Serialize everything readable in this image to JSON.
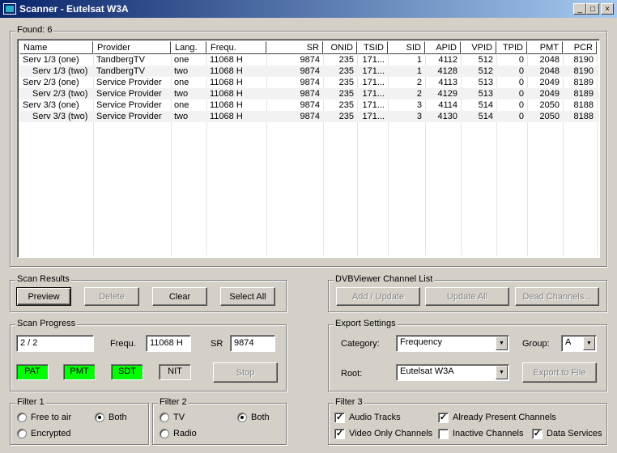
{
  "window": {
    "title": "Scanner - Eutelsat W3A",
    "min": "_",
    "max": "□",
    "close": "×"
  },
  "found": {
    "label": "Found:",
    "count": "6"
  },
  "columns": [
    "Name",
    "Provider",
    "Lang.",
    "Frequ.",
    "SR",
    "ONID",
    "TSID",
    "SID",
    "APID",
    "VPID",
    "TPID",
    "PMT",
    "PCR"
  ],
  "rows": [
    [
      "Serv 1/3 (one)",
      "TandbergTV",
      "one",
      "11068 H",
      "9874",
      "235",
      "171...",
      "1",
      "4112",
      "512",
      "0",
      "2048",
      "8190"
    ],
    [
      "Serv 1/3 (two)",
      "TandbergTV",
      "two",
      "11068 H",
      "9874",
      "235",
      "171...",
      "1",
      "4128",
      "512",
      "0",
      "2048",
      "8190"
    ],
    [
      "Serv 2/3 (one)",
      "Service Provider",
      "one",
      "11068 H",
      "9874",
      "235",
      "171...",
      "2",
      "4113",
      "513",
      "0",
      "2049",
      "8189"
    ],
    [
      "Serv 2/3 (two)",
      "Service Provider",
      "two",
      "11068 H",
      "9874",
      "235",
      "171...",
      "2",
      "4129",
      "513",
      "0",
      "2049",
      "8189"
    ],
    [
      "Serv 3/3 (one)",
      "Service Provider",
      "one",
      "11068 H",
      "9874",
      "235",
      "171...",
      "3",
      "4114",
      "514",
      "0",
      "2050",
      "8188"
    ],
    [
      "Serv 3/3 (two)",
      "Service Provider",
      "two",
      "11068 H",
      "9874",
      "235",
      "171...",
      "3",
      "4130",
      "514",
      "0",
      "2050",
      "8188"
    ]
  ],
  "scan_results": {
    "title": "Scan Results",
    "preview": "Preview",
    "delete": "Delete",
    "clear": "Clear",
    "select_all": "Select All"
  },
  "channel_list": {
    "title": "DVBViewer Channel List",
    "add_update": "Add / Update",
    "update_all": "Update All",
    "dead_channels": "Dead Channels..."
  },
  "scan_progress": {
    "title": "Scan Progress",
    "progress": "2 / 2",
    "frequ_label": "Frequ.",
    "frequ_value": "11068 H",
    "sr_label": "SR",
    "sr_value": "9874",
    "pat": "PAT",
    "pmt": "PMT",
    "sdt": "SDT",
    "nit": "NIT",
    "stop": "Stop"
  },
  "export_settings": {
    "title": "Export Settings",
    "category_label": "Category:",
    "category_value": "Frequency",
    "group_label": "Group:",
    "group_value": "A",
    "root_label": "Root:",
    "root_value": "Eutelsat W3A",
    "export_to_file": "Export to File"
  },
  "filter1": {
    "title": "Filter 1",
    "free_to_air": "Free to air",
    "both": "Both",
    "encrypted": "Encrypted"
  },
  "filter2": {
    "title": "Filter 2",
    "tv": "TV",
    "both": "Both",
    "radio": "Radio"
  },
  "filter3": {
    "title": "Filter 3",
    "audio_tracks": "Audio Tracks",
    "already_present": "Already Present Channels",
    "video_only": "Video Only Channels",
    "inactive": "Inactive Channels",
    "data_services": "Data Services"
  },
  "colors": {
    "title_start": "#0a246a",
    "title_end": "#a6caf0",
    "indicator_on": "#00ff00"
  }
}
